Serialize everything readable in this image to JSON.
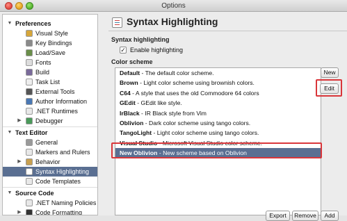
{
  "window": {
    "title": "Options"
  },
  "sidebar": {
    "categories": [
      {
        "label": "Preferences",
        "expanded": true,
        "items": [
          {
            "label": "Visual Style",
            "icon": "visual-style-icon",
            "color": "#d6a63a"
          },
          {
            "label": "Key Bindings",
            "icon": "key-bindings-icon",
            "color": "#8a8a8a"
          },
          {
            "label": "Load/Save",
            "icon": "load-save-icon",
            "color": "#6a8f4a"
          },
          {
            "label": "Fonts",
            "icon": "fonts-icon",
            "color": "#dddddd"
          },
          {
            "label": "Build",
            "icon": "build-icon",
            "color": "#7a6a9a"
          },
          {
            "label": "Task List",
            "icon": "task-list-icon",
            "color": "#eeeeee"
          },
          {
            "label": "External Tools",
            "icon": "external-tools-icon",
            "color": "#555555"
          },
          {
            "label": "Author Information",
            "icon": "author-icon",
            "color": "#4a78b4"
          },
          {
            "label": ".NET Runtimes",
            "icon": "runtimes-icon",
            "color": "#e8e8e8"
          },
          {
            "label": "Debugger",
            "icon": "debugger-icon",
            "color": "#4a9a5a",
            "has_arrow": true
          }
        ]
      },
      {
        "label": "Text Editor",
        "expanded": true,
        "items": [
          {
            "label": "General",
            "icon": "general-icon",
            "color": "#9a9a9a"
          },
          {
            "label": "Markers and Rulers",
            "icon": "markers-icon",
            "color": "#e8e8e8"
          },
          {
            "label": "Behavior",
            "icon": "behavior-icon",
            "color": "#c8a050",
            "has_arrow": true
          },
          {
            "label": "Syntax Highlighting",
            "icon": "syntax-icon",
            "color": "#ffffff",
            "selected": true
          },
          {
            "label": "Code Templates",
            "icon": "code-templates-icon",
            "color": "#e8e8e8"
          }
        ]
      },
      {
        "label": "Source Code",
        "expanded": true,
        "items": [
          {
            "label": ".NET Naming Policies",
            "icon": "naming-icon",
            "color": "#e8e8e8"
          },
          {
            "label": "Code Formatting",
            "icon": "code-formatting-icon",
            "color": "#333333",
            "has_arrow": true
          }
        ]
      }
    ]
  },
  "main": {
    "title": "Syntax Highlighting",
    "syntax_section": "Syntax highlighting",
    "enable_checkbox": {
      "label": "Enable highlighting",
      "checked": true,
      "mark": "✓"
    },
    "color_section": "Color scheme",
    "schemes": [
      {
        "name": "Default",
        "desc": " - The default color scheme."
      },
      {
        "name": "Brown",
        "desc": " - Light color scheme using brownish colors."
      },
      {
        "name": "C64",
        "desc": " - A style that uses the old Commodore 64 colors"
      },
      {
        "name": "GEdit",
        "desc": " - GEdit like style."
      },
      {
        "name": "IrBlack",
        "desc": " - IR Black style from Vim"
      },
      {
        "name": "Oblivion",
        "desc": " - Dark color scheme using tango colors."
      },
      {
        "name": "TangoLight",
        "desc": " - Light color scheme using tango colors."
      },
      {
        "name": "Visual Studio",
        "desc": " - Microsoft Visual Studio color scheme."
      },
      {
        "name": "New Oblivion",
        "desc": " - New scheme based on Oblivion",
        "selected": true
      }
    ],
    "buttons": {
      "new": "New",
      "edit": "Edit",
      "export": "Export",
      "remove": "Remove",
      "add": "Add"
    }
  },
  "colors": {
    "selection": "#5a6f92",
    "annotation": "#d9363a"
  }
}
